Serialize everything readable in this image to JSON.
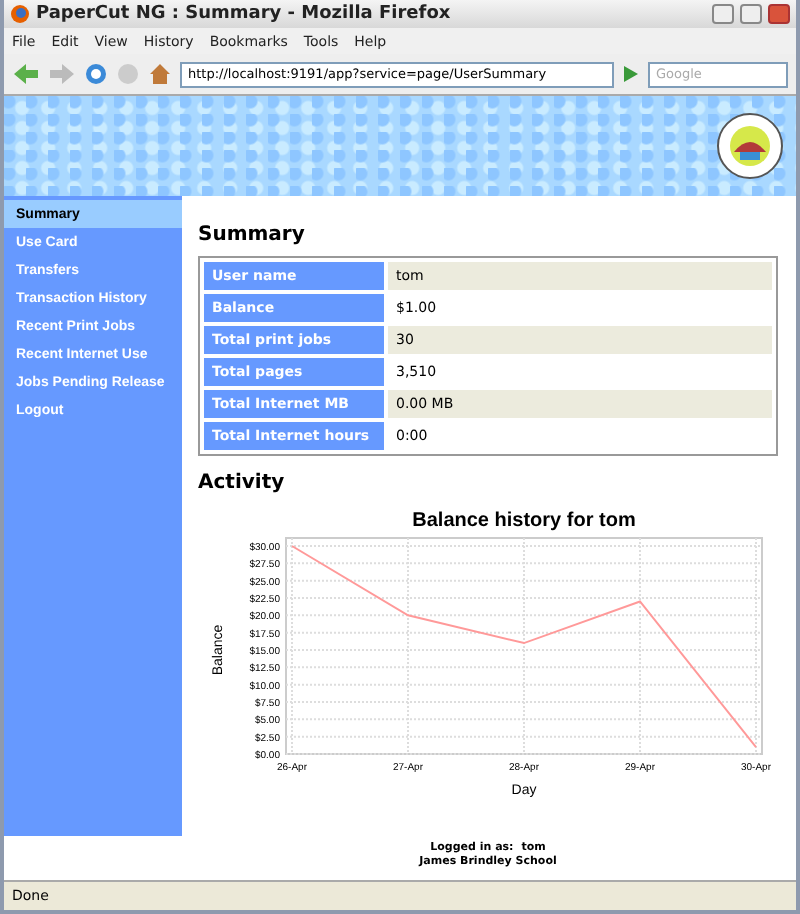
{
  "window": {
    "title": "PaperCut NG : Summary - Mozilla Firefox"
  },
  "menu": [
    "File",
    "Edit",
    "View",
    "History",
    "Bookmarks",
    "Tools",
    "Help"
  ],
  "toolbar": {
    "url": "http://localhost:9191/app?service=page/UserSummary",
    "search_placeholder": "Google"
  },
  "sidebar": {
    "items": [
      {
        "label": "Summary",
        "selected": true
      },
      {
        "label": "Use Card",
        "selected": false
      },
      {
        "label": "Transfers",
        "selected": false
      },
      {
        "label": "Transaction History",
        "selected": false
      },
      {
        "label": "Recent Print Jobs",
        "selected": false
      },
      {
        "label": "Recent Internet Use",
        "selected": false
      },
      {
        "label": "Jobs Pending Release",
        "selected": false
      },
      {
        "label": "Logout",
        "selected": false
      }
    ]
  },
  "summary": {
    "heading": "Summary",
    "rows": [
      {
        "label": "User name",
        "value": "tom"
      },
      {
        "label": "Balance",
        "value": "$1.00"
      },
      {
        "label": "Total print jobs",
        "value": "30"
      },
      {
        "label": "Total pages",
        "value": "3,510"
      },
      {
        "label": "Total Internet MB",
        "value": "0.00 MB"
      },
      {
        "label": "Total Internet hours",
        "value": "0:00"
      }
    ]
  },
  "activity": {
    "heading": "Activity",
    "chart_data": {
      "type": "line",
      "title": "Balance history for tom",
      "xlabel": "Day",
      "ylabel": "Balance",
      "categories": [
        "26-Apr",
        "27-Apr",
        "28-Apr",
        "29-Apr",
        "30-Apr"
      ],
      "series": [
        {
          "color": "#ff9999",
          "values": [
            30,
            20,
            16,
            22,
            1
          ]
        }
      ],
      "grid": true,
      "ylim": [
        0,
        30
      ],
      "yticks": [
        {
          "value": 0,
          "label": "$0.00"
        },
        {
          "value": 2.5,
          "label": "$2.50"
        },
        {
          "value": 5,
          "label": "$5.00"
        },
        {
          "value": 7.5,
          "label": "$7.50"
        },
        {
          "value": 10,
          "label": "$10.00"
        },
        {
          "value": 12.5,
          "label": "$12.50"
        },
        {
          "value": 15,
          "label": "$15.00"
        },
        {
          "value": 17.5,
          "label": "$17.50"
        },
        {
          "value": 20,
          "label": "$20.00"
        },
        {
          "value": 22.5,
          "label": "$22.50"
        },
        {
          "value": 25,
          "label": "$25.00"
        },
        {
          "value": 27.5,
          "label": "$27.50"
        },
        {
          "value": 30,
          "label": "$30.00"
        }
      ]
    }
  },
  "footer": {
    "logged_in_label": "Logged in as:",
    "user": "tom",
    "organization": "James Brindley School"
  },
  "status_bar": {
    "text": "Done"
  }
}
